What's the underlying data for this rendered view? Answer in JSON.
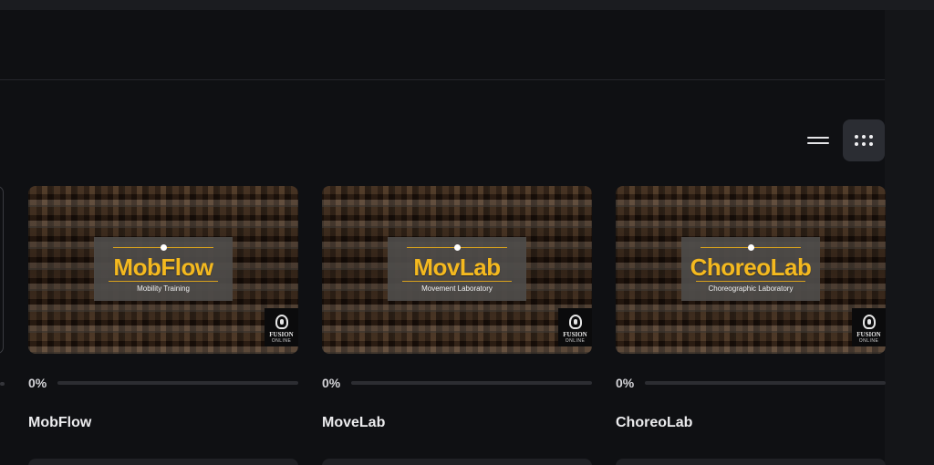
{
  "view_toggle": {
    "options": [
      {
        "name": "list-view",
        "icon": "list-icon",
        "active": false
      },
      {
        "name": "grid-view",
        "icon": "grid-dots-icon",
        "active": true
      }
    ]
  },
  "courses": [
    {
      "title": "MobFlow",
      "progress": 0,
      "progress_label": "0%",
      "thumb_brand": "MobFlow",
      "thumb_subtitle": "Mobility Training",
      "badge_text": "FUSION",
      "badge_sub": "ONLINE"
    },
    {
      "title": "MoveLab",
      "progress": 0,
      "progress_label": "0%",
      "thumb_brand": "MovLab",
      "thumb_subtitle": "Movement Laboratory",
      "badge_text": "FUSION",
      "badge_sub": "ONLINE"
    },
    {
      "title": "ChoreoLab",
      "progress": 0,
      "progress_label": "0%",
      "thumb_brand": "ChoreoLab",
      "thumb_subtitle": "Choreographic Laboratory",
      "badge_text": "FUSION",
      "badge_sub": "ONLINE"
    }
  ],
  "colors": {
    "background": "#0f1013",
    "accent": "#f4b91f",
    "track": "#2c2d32",
    "active_toggle": "#2b2d33"
  }
}
